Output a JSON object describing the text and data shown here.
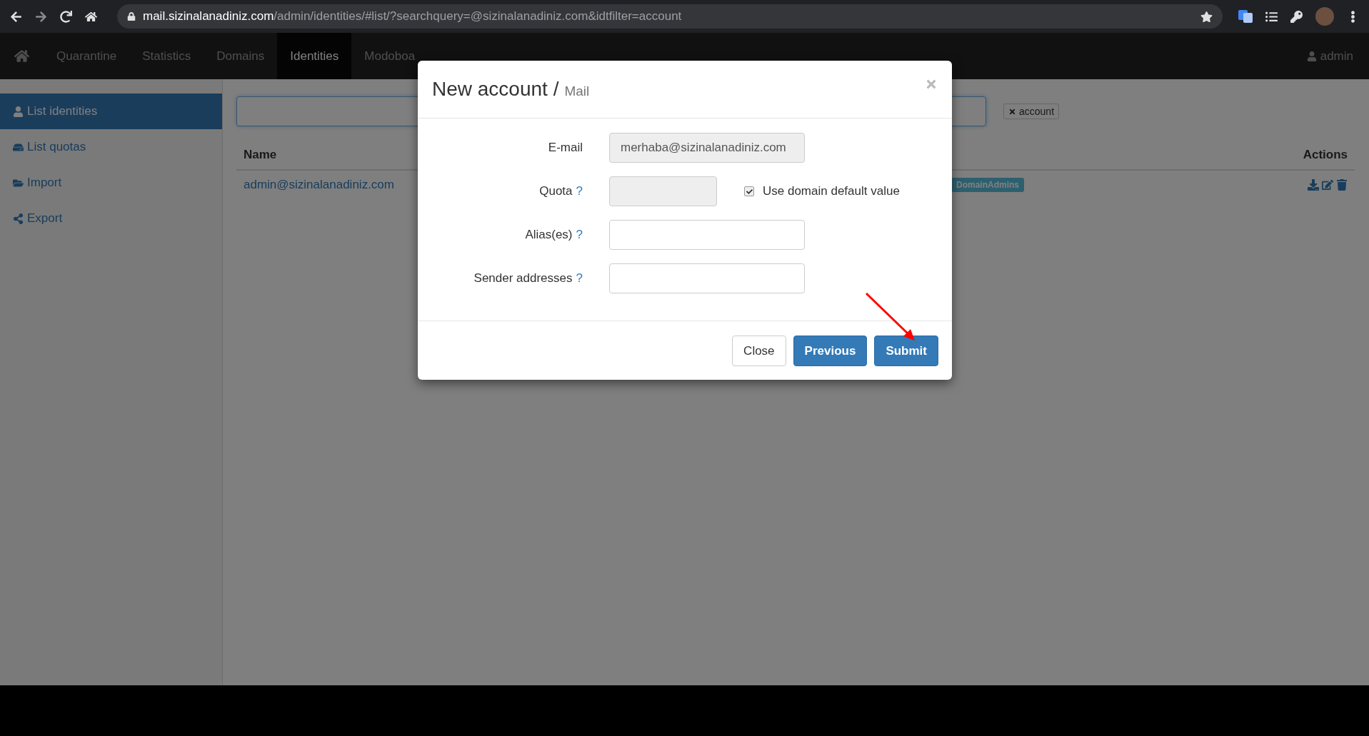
{
  "browser": {
    "url_host": "mail.sizinalanadiniz.com",
    "url_path": "/admin/identities/#list/?searchquery=@sizinalanadiniz.com&idtfilter=account"
  },
  "navbar": {
    "items": [
      {
        "label": "Quarantine",
        "selected": false
      },
      {
        "label": "Statistics",
        "selected": false
      },
      {
        "label": "Domains",
        "selected": false
      },
      {
        "label": "Identities",
        "selected": true
      },
      {
        "label": "Modoboa",
        "selected": false
      }
    ],
    "user": "admin"
  },
  "sidebar": {
    "items": [
      {
        "label": "List identities",
        "selected": true
      },
      {
        "label": "List quotas",
        "selected": false
      },
      {
        "label": "Import",
        "selected": false
      },
      {
        "label": "Export",
        "selected": false
      }
    ]
  },
  "filter_tag": "account",
  "table": {
    "columns": [
      "Name",
      "Actions"
    ],
    "rows": [
      {
        "name": "admin@sizinalanadiniz.com",
        "tag": "DomainAdmins"
      }
    ]
  },
  "modal": {
    "title": "New account",
    "separator": "/",
    "subtitle": "Mail",
    "fields": [
      {
        "kind": "text",
        "label": "E-mail",
        "value": "merhaba@sizinalanadiniz.com",
        "disabled": true
      },
      {
        "kind": "quota",
        "label": "Quota",
        "help": "?",
        "disabled": true,
        "checkbox_label": "Use domain default value",
        "checked": true
      },
      {
        "kind": "text",
        "label": "Alias(es)",
        "help": "?",
        "disabled": false
      },
      {
        "kind": "text",
        "label": "Sender addresses",
        "help": "?",
        "disabled": false
      }
    ],
    "buttons": [
      {
        "label": "Close",
        "kind": "default"
      },
      {
        "label": "Previous",
        "kind": "primary"
      },
      {
        "label": "Submit",
        "kind": "primary"
      }
    ]
  }
}
